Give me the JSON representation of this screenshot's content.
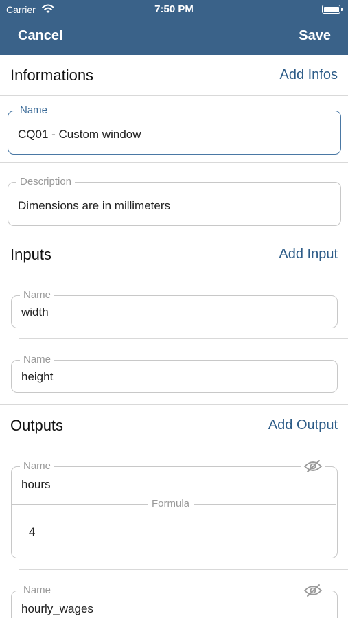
{
  "status_bar": {
    "carrier": "Carrier",
    "time": "7:50 PM"
  },
  "nav": {
    "cancel_label": "Cancel",
    "save_label": "Save",
    "bar_color": "#3a6289"
  },
  "informations": {
    "title": "Informations",
    "action_label": "Add Infos",
    "name_field": {
      "label": "Name",
      "value": "CQ01 - Custom window"
    },
    "description_field": {
      "label": "Description",
      "value": "Dimensions are in millimeters"
    }
  },
  "inputs": {
    "title": "Inputs",
    "action_label": "Add Input",
    "items": [
      {
        "label": "Name",
        "value": "width"
      },
      {
        "label": "Name",
        "value": "height"
      }
    ]
  },
  "outputs": {
    "title": "Outputs",
    "action_label": "Add Output",
    "items": [
      {
        "label": "Name",
        "value": "hours",
        "formula_label": "Formula",
        "formula_value": "4",
        "visibility_icon": "eye-slash-icon"
      },
      {
        "label": "Name",
        "value": "hourly_wages",
        "visibility_icon": "eye-slash-icon"
      }
    ]
  },
  "colors": {
    "accent": "#2d5c88",
    "active_border": "#4a78a4",
    "field_border": "#c8c8c8"
  }
}
